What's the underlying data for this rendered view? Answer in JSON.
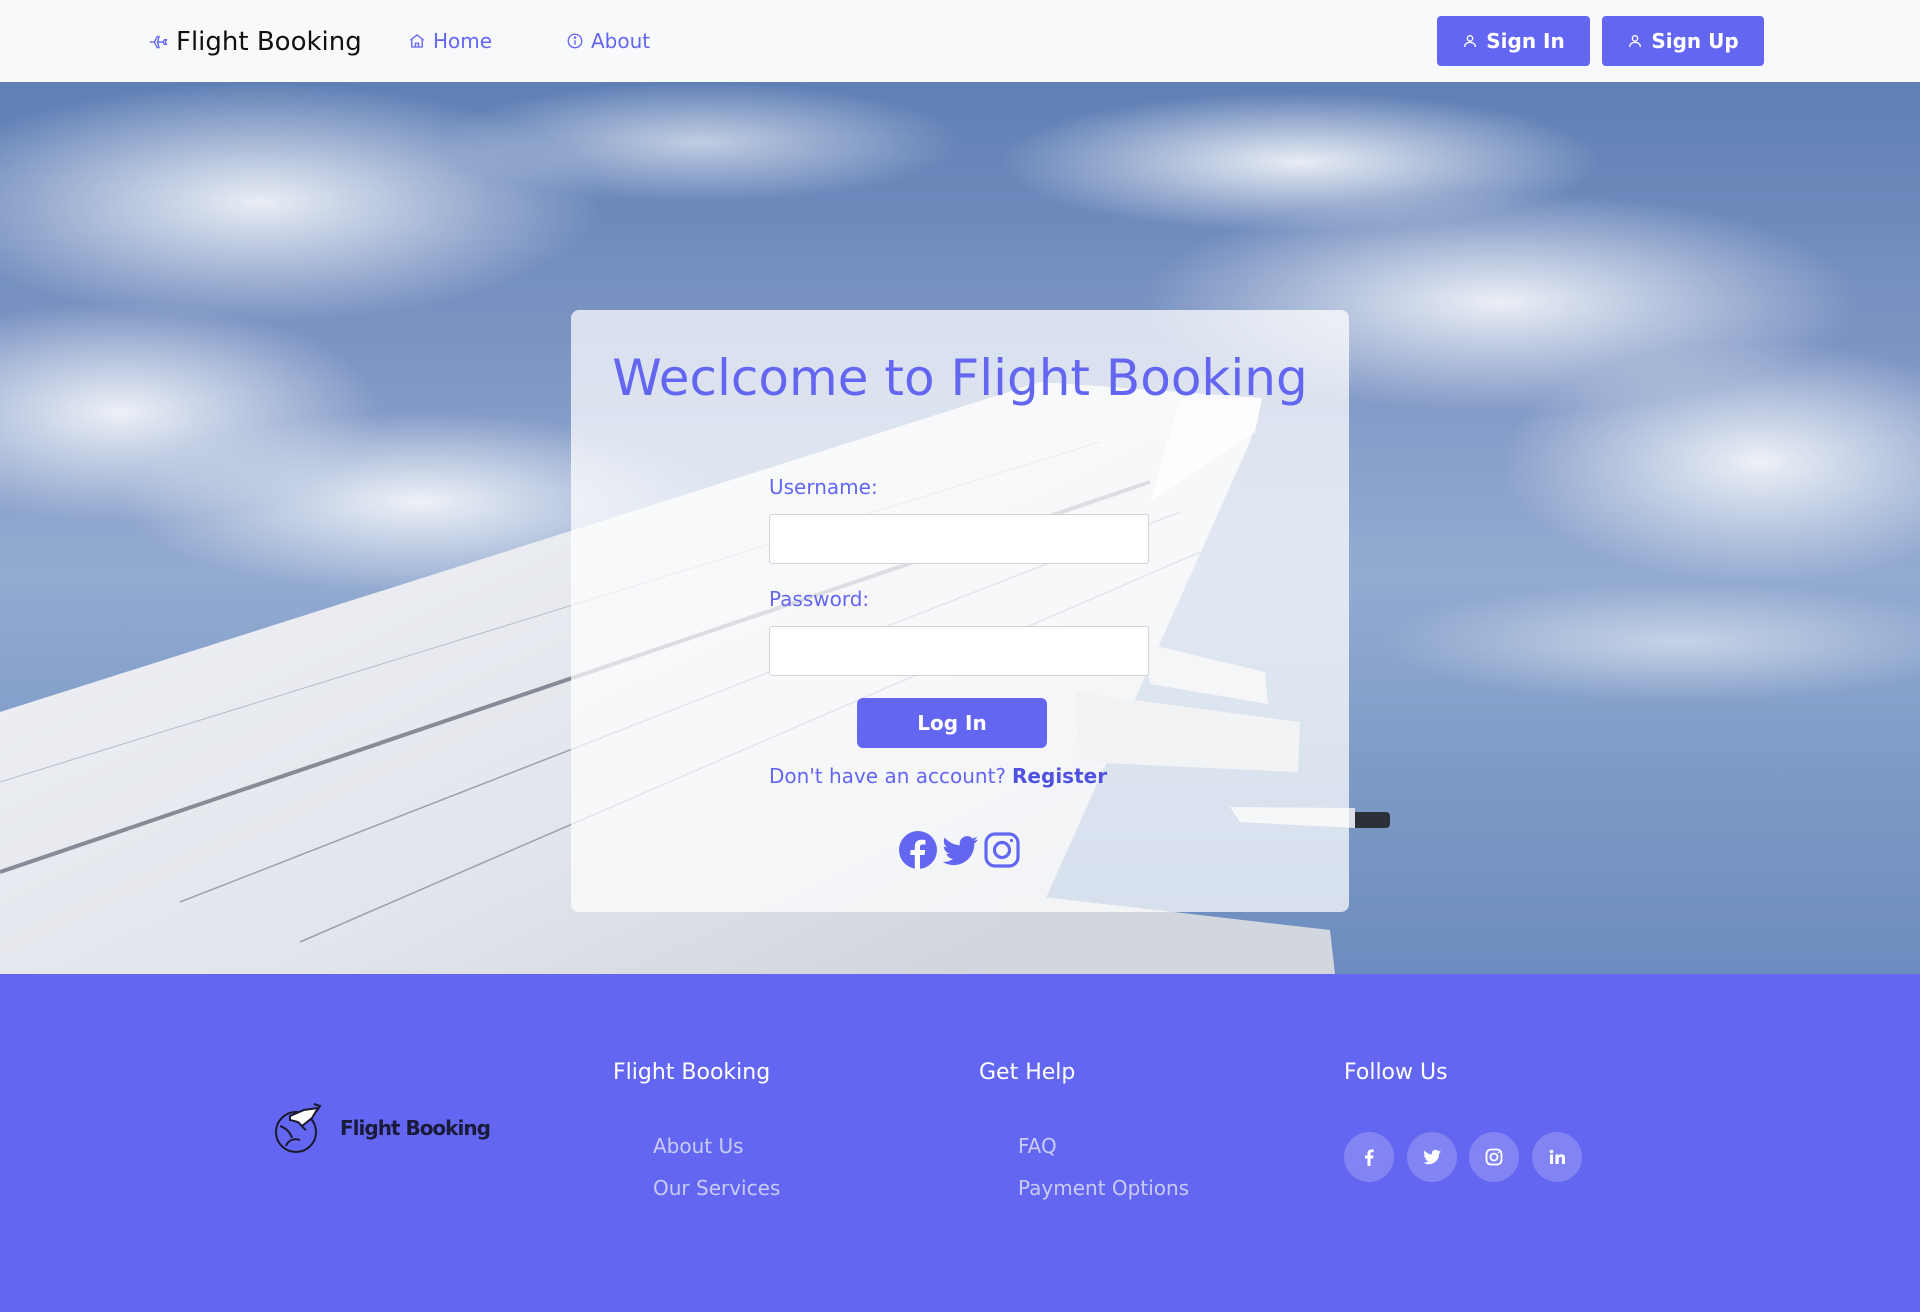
{
  "nav": {
    "brand": "Flight Booking",
    "links": [
      {
        "label": "Home",
        "icon": "home-icon"
      },
      {
        "label": "About",
        "icon": "info-icon"
      }
    ],
    "sign_in": "Sign In",
    "sign_up": "Sign Up"
  },
  "login": {
    "title": "Weclcome to Flight Booking",
    "username_label": "Username:",
    "username_value": "",
    "password_label": "Password:",
    "password_value": "",
    "submit": "Log In",
    "register_prompt": "Don't have an account?",
    "register_link": "Register",
    "socials": [
      "facebook-icon",
      "twitter-icon",
      "instagram-icon"
    ]
  },
  "footer": {
    "logo_text": "Flight Booking",
    "columns": [
      {
        "title": "Flight Booking",
        "links": [
          "About Us",
          "Our Services"
        ]
      },
      {
        "title": "Get Help",
        "links": [
          "FAQ",
          "Payment Options"
        ]
      },
      {
        "title": "Follow Us",
        "socials": [
          "facebook-icon",
          "twitter-icon",
          "instagram-icon",
          "linkedin-icon"
        ]
      }
    ]
  },
  "colors": {
    "accent": "#6366f1",
    "navbar_bg": "#f8f9fa",
    "footer_bg": "#6366f1"
  }
}
